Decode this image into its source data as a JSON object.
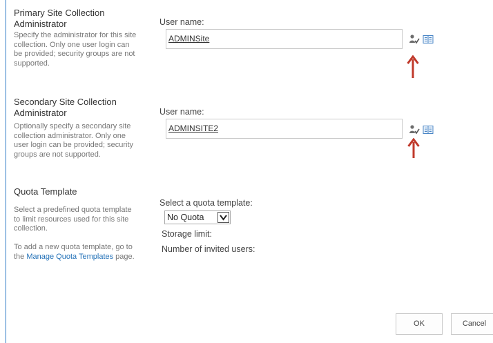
{
  "primary": {
    "title": "Primary Site Collection Administrator",
    "description": "Specify the administrator for this site collection. Only one user login can be provided; security groups are not supported.",
    "user_label": "User name:",
    "user_value": "ADMINSite"
  },
  "secondary": {
    "title": "Secondary Site Collection Administrator",
    "description": "Optionally specify a secondary site collection administrator. Only one user login can be provided; security groups are not supported.",
    "user_label": "User name:",
    "user_value": "ADMINSITE2"
  },
  "quota": {
    "title": "Quota Template",
    "description": "Select a predefined quota template to limit resources used for this site collection.",
    "add_text_before": "To add a new quota template, go to the ",
    "link_text": "Manage Quota Templates",
    "add_text_after": " page.",
    "select_label": "Select a quota template:",
    "selected_value": "No Quota",
    "storage_label": "Storage limit:",
    "invited_label": "Number of invited users:"
  },
  "buttons": {
    "ok": "OK",
    "cancel": "Cancel"
  },
  "colors": {
    "frame_border": "#2b79c4",
    "link": "#2472b8",
    "annotation_arrow": "#c0392b"
  }
}
